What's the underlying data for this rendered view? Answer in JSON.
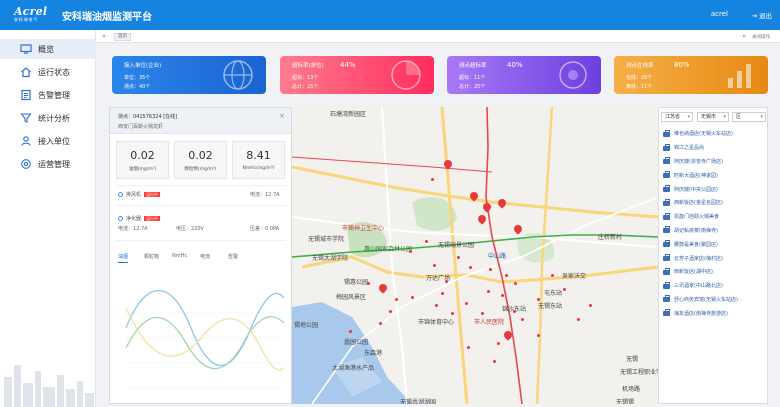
{
  "header": {
    "logo_text": "Acrel",
    "logo_sub": "安科瑞电气",
    "title": "安科瑞油烟监测平台",
    "user": "acrel",
    "logout": "退出"
  },
  "sidebar": {
    "items": [
      {
        "label": "概览",
        "icon": "monitor-icon"
      },
      {
        "label": "运行状态",
        "icon": "home-icon"
      },
      {
        "label": "告警管理",
        "icon": "document-icon"
      },
      {
        "label": "统计分析",
        "icon": "funnel-icon"
      },
      {
        "label": "接入单位",
        "icon": "people-icon"
      },
      {
        "label": "运营管理",
        "icon": "gear-icon"
      }
    ]
  },
  "tabs": {
    "home": "首页",
    "close_label": "关闭操作"
  },
  "cards": [
    {
      "title": "接入单位(企业)",
      "pct": "",
      "line1": "单位：35个",
      "line2": "测点：40个"
    },
    {
      "title": "超标率(单位)",
      "pct": "44%",
      "line1": "超标：13个",
      "line2": "总计：25个"
    },
    {
      "title": "测点超标率",
      "pct": "40%",
      "line1": "超标：11个",
      "line2": "总计：25个"
    },
    {
      "title": "测点在线率",
      "pct": "80%",
      "line1": "在线：20个",
      "line2": "离线：11个"
    }
  ],
  "detail": {
    "point": "测点：041576324 [在线]",
    "location": "西安门百斯火锅龙虾",
    "metrics": [
      {
        "value": "0.02",
        "unit": "油烟(mg/m³)"
      },
      {
        "value": "0.02",
        "unit": "颗粒物(mg/m³)"
      },
      {
        "value": "8.41",
        "unit": "NmHc(mg/m³)"
      }
    ],
    "fan": {
      "label": "排风机",
      "status": "运行中",
      "current": "电流：12.7A"
    },
    "purifier": {
      "label": "净化器",
      "status": "运行中",
      "current": "电流：12.7A",
      "voltage": "电压：220V",
      "pressure": "压差：0.0PA"
    },
    "chart_tabs": [
      "油烟",
      "颗粒物",
      "NmHc",
      "电流",
      "告警"
    ]
  },
  "map": {
    "labels": [
      {
        "text": "石塘湾新园区",
        "cls": ""
      },
      {
        "text": "市锡神卫生中心",
        "cls": "red"
      },
      {
        "text": "无锡城市学院",
        "cls": ""
      },
      {
        "text": "惠山国家森林公园",
        "cls": "green"
      },
      {
        "text": "无锡瑞景公园",
        "cls": ""
      },
      {
        "text": "无锡太湖学院",
        "cls": ""
      },
      {
        "text": "中山路",
        "cls": "blue"
      },
      {
        "text": "万达广场",
        "cls": ""
      },
      {
        "text": "锡惠公园",
        "cls": ""
      },
      {
        "text": "梅园风景区",
        "cls": ""
      },
      {
        "text": "市锦体育中心",
        "cls": ""
      },
      {
        "text": "锡地公园",
        "cls": ""
      },
      {
        "text": "蠡园公园",
        "cls": ""
      },
      {
        "text": "东森港",
        "cls": ""
      },
      {
        "text": "太湖渔港水产品",
        "cls": ""
      },
      {
        "text": "市人民医院",
        "cls": "red"
      },
      {
        "text": "无锡东站",
        "cls": ""
      },
      {
        "text": "锦沙东站",
        "cls": ""
      },
      {
        "text": "屯东站",
        "cls": ""
      },
      {
        "text": "吴家沃交",
        "cls": ""
      },
      {
        "text": "无锡蠡湖湖国",
        "cls": ""
      },
      {
        "text": "庄桥新村",
        "cls": ""
      },
      {
        "text": "无锡工程职业学院",
        "cls": ""
      },
      {
        "text": "机场路",
        "cls": ""
      },
      {
        "text": "无锡锡",
        "cls": ""
      },
      {
        "text": "无锡",
        "cls": ""
      }
    ]
  },
  "rpanel": {
    "province": "江苏省",
    "city": "无锡市",
    "district": "区",
    "items": [
      "维也纳酒店(无锡火车站店)",
      "锦江之星品尚",
      "阿庆嫂(崇安寺广场店)",
      "时新大酒店(神家园)",
      "阿庆嫂(中央公园店)",
      "西新饭店(金星名园店)",
      "凯旋门自助火锅美食",
      "胡记私房菜(南禅寺)",
      "腰鼓是美食(聚园店)",
      "云芳子酒家店(梅村店)",
      "西新饭店(湖中店)",
      "三讯酒家(中山路北店)",
      "舒心商务宾馆(无锡火车站店)",
      "海友酒店(南禅寺旅游店)"
    ]
  },
  "colors": {
    "header": "#1583e0",
    "card_blue": "#1a63d2",
    "card_red": "#ff2d5c",
    "card_purple": "#6c3fe0",
    "card_orange": "#e68913",
    "map_marker": "#e8393a"
  }
}
